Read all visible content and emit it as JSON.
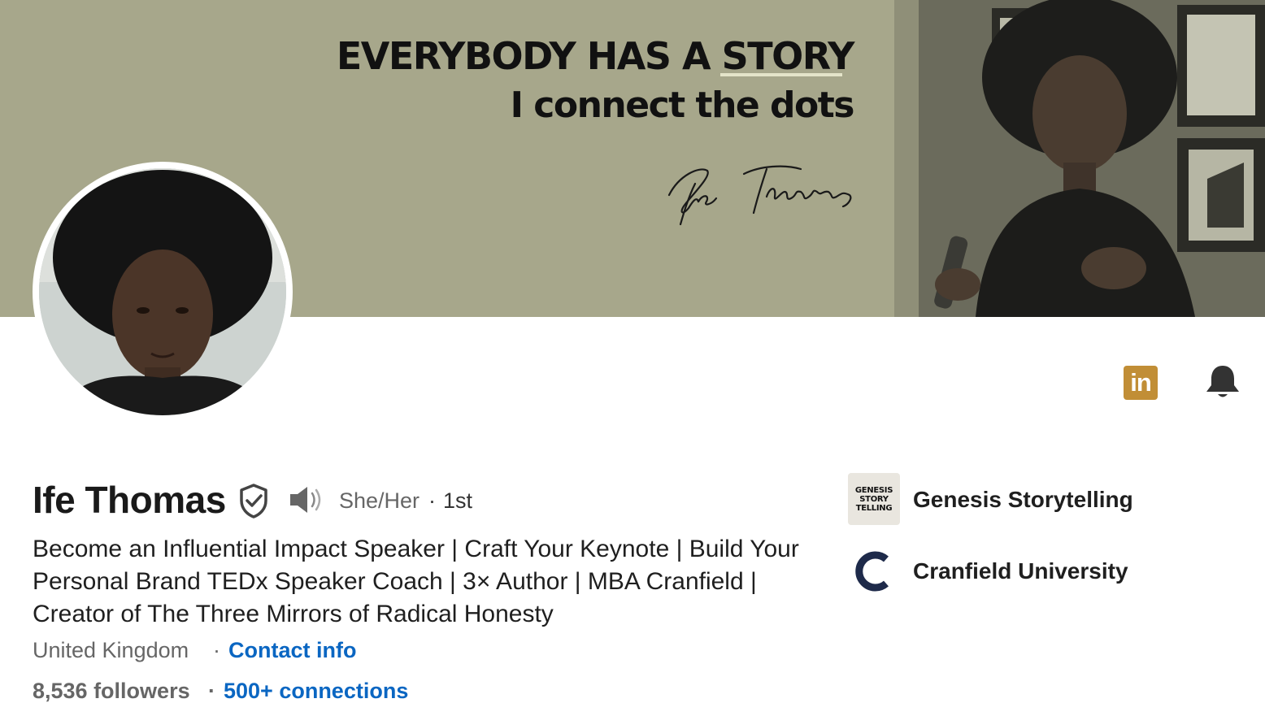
{
  "banner": {
    "headline": "EVERYBODY HAS A STORY",
    "subline": "I connect the dots",
    "signature": "Ife Thomas"
  },
  "profile": {
    "name": "Ife Thomas",
    "pronouns": "She/Her",
    "separator": "·",
    "degree": "1st",
    "headline": "Become an Influential Impact Speaker | Craft Your Keynote | Build Your Personal Brand TEDx Speaker Coach | 3× Author | MBA Cranfield | Creator of The Three Mirrors of Radical Honesty",
    "location": "United Kingdom",
    "contact_info": "Contact info",
    "followers": "8,536 followers",
    "connections": "500+ connections"
  },
  "icons": {
    "linkedin_badge": "in",
    "verified": "shield-check-icon",
    "pronunciation": "speaker-icon",
    "notifications": "bell-icon"
  },
  "organizations": [
    {
      "name": "Genesis Storytelling",
      "logo_lines": [
        "GENESIS",
        "STORY",
        "TELLING"
      ]
    },
    {
      "name": "Cranfield University"
    }
  ],
  "colors": {
    "banner_bg": "#a7a78b",
    "link": "#0a66c2",
    "linkedin_badge": "#c18e36",
    "cranfield_logo": "#1e2a4a"
  }
}
